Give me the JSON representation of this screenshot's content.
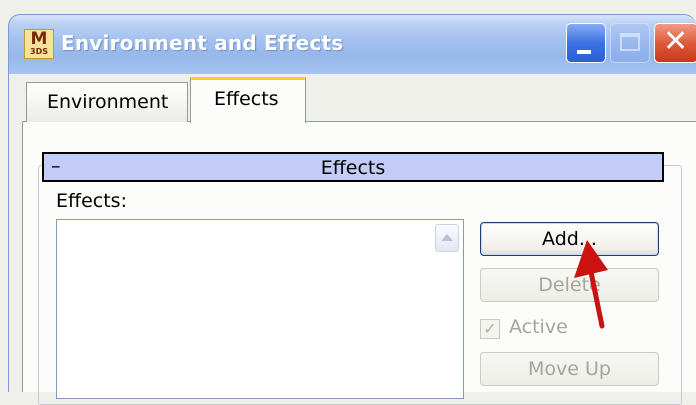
{
  "window": {
    "title": "Environment and Effects",
    "icon_text_top": "M",
    "icon_text_bottom": "3DS"
  },
  "tabs": [
    {
      "label": "Environment",
      "selected": false
    },
    {
      "label": "Effects",
      "selected": true
    }
  ],
  "rollout": {
    "toggle": "–",
    "title": "Effects"
  },
  "effects_panel": {
    "list_label": "Effects:",
    "list_items": [],
    "buttons": {
      "add": "Add...",
      "delete": "Delete",
      "move_up": "Move Up"
    },
    "active_checkbox": {
      "label": "Active",
      "checked": true,
      "enabled": false
    }
  },
  "colors": {
    "rollout_header": "#c3cbf7",
    "tab_highlight": "#ffc83c",
    "arrow": "#cc1111"
  }
}
